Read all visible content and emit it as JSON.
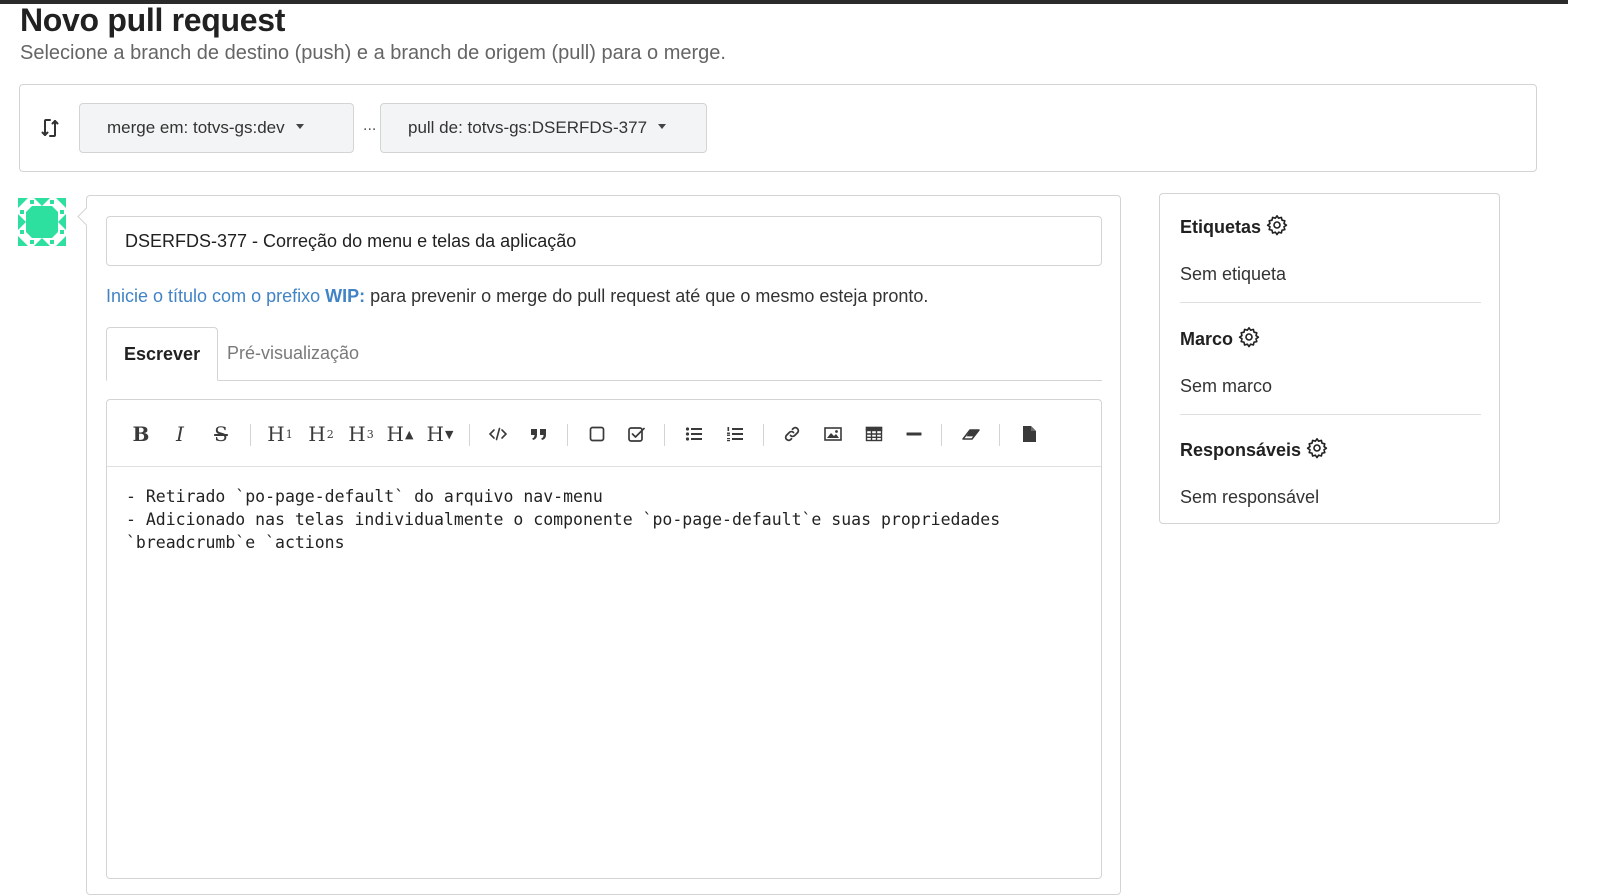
{
  "page": {
    "title": "Novo pull request",
    "subtitle": "Selecione a branch de destino (push) e a branch de origem (pull) para o merge."
  },
  "compare": {
    "icon": "compare-arrows-icon",
    "base_label": "merge em: totvs-gs:dev",
    "separator": "...",
    "head_label": "pull de: totvs-gs:DSERFDS-377"
  },
  "avatar": {
    "icon": "identicon-avatar",
    "color": "#2ee0a0"
  },
  "form": {
    "title_value": "DSERFDS-377 - Correção do menu e telas da aplicação",
    "wip_hint": {
      "prefix": "Inicie o título com o prefixo ",
      "keyword": "WIP:",
      "suffix": " para prevenir o merge do pull request até que o mesmo esteja pronto."
    },
    "tabs": {
      "write": "Escrever",
      "preview": "Pré-visualização"
    },
    "toolbar": {
      "bold": "B",
      "italic": "I",
      "strike": "S",
      "h1": "H",
      "h1_sub": "1",
      "h2": "H",
      "h2_sub": "2",
      "h3": "H",
      "h3_sub": "3",
      "h_bigger": "H",
      "h_bigger_sub": "▲",
      "h_smaller": "H",
      "h_smaller_sub": "▼"
    },
    "body": "- Retirado `po-page-default` do arquivo nav-menu\n- Adicionado nas telas individualmente o componente `po-page-default`e suas propriedades `breadcrumb`e `actions"
  },
  "sidebar": {
    "labels": {
      "title": "Etiquetas",
      "value": "Sem etiqueta"
    },
    "milestone": {
      "title": "Marco",
      "value": "Sem marco"
    },
    "assignees": {
      "title": "Responsáveis",
      "value": "Sem responsável"
    }
  },
  "colors": {
    "link": "#4183c4",
    "border": "#d4d4d5",
    "button_bg": "#f3f4f5"
  }
}
